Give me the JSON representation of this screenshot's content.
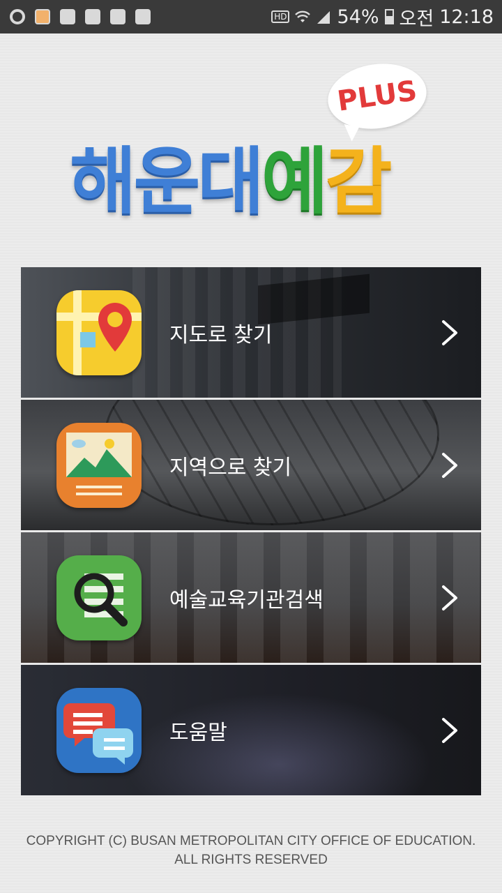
{
  "status_bar": {
    "battery": "54%",
    "period": "오전",
    "time": "12:18",
    "hd_label": "HD"
  },
  "logo": {
    "part1": "해운대",
    "part2": "예",
    "part3": "감",
    "badge": "PLUS"
  },
  "menu": {
    "items": [
      {
        "label": "지도로 찾기",
        "icon": "map-pin-icon"
      },
      {
        "label": "지역으로 찾기",
        "icon": "landscape-icon"
      },
      {
        "label": "예술교육기관검색",
        "icon": "search-list-icon"
      },
      {
        "label": "도움말",
        "icon": "chat-bubbles-icon"
      }
    ]
  },
  "footer": {
    "line1": "COPYRIGHT (C) BUSAN METROPOLITAN CITY OFFICE OF EDUCATION.",
    "line2": "ALL RIGHTS RESERVED"
  },
  "colors": {
    "logo_blue": "#3f7fd6",
    "logo_green": "#2ea33a",
    "logo_yellow": "#f4b21c",
    "plus_red": "#e23a3a"
  }
}
